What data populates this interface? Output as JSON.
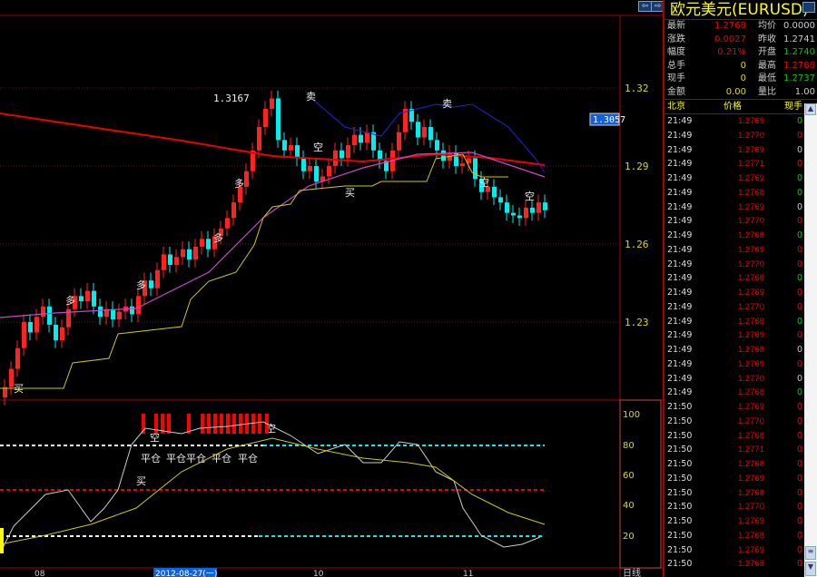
{
  "chart": {
    "nav_left": "⇦",
    "nav_right": "⇨",
    "price_ticks": [
      "1.32",
      "1.29",
      "1.26",
      "1.23"
    ],
    "current_price_tag": "1.3057",
    "peak_label": "1.3167",
    "osc_ticks": [
      "100",
      "80",
      "60",
      "40",
      "20"
    ],
    "date_ticks": [
      "08",
      "10",
      "11"
    ],
    "cursor_date": "2012-08-27(一)",
    "period": "日线",
    "signals": {
      "sell": "卖",
      "buy": "买",
      "short": "空",
      "long": "多",
      "close": "平仓"
    }
  },
  "chart_data": {
    "type": "candlestick",
    "ylim": [
      1.2,
      1.335
    ],
    "closes": [
      1.205,
      1.212,
      1.22,
      1.23,
      1.226,
      1.232,
      1.236,
      1.229,
      1.223,
      1.228,
      1.235,
      1.24,
      1.238,
      1.242,
      1.236,
      1.232,
      1.235,
      1.231,
      1.234,
      1.236,
      1.233,
      1.24,
      1.246,
      1.243,
      1.25,
      1.256,
      1.252,
      1.255,
      1.258,
      1.254,
      1.259,
      1.262,
      1.258,
      1.263,
      1.266,
      1.27,
      1.276,
      1.282,
      1.288,
      1.296,
      1.305,
      1.312,
      1.316,
      1.3,
      1.296,
      1.298,
      1.293,
      1.288,
      1.29,
      1.284,
      1.286,
      1.29,
      1.296,
      1.293,
      1.298,
      1.302,
      1.299,
      1.303,
      1.296,
      1.292,
      1.288,
      1.296,
      1.303,
      1.312,
      1.307,
      1.301,
      1.305,
      1.3,
      1.296,
      1.292,
      1.295,
      1.29,
      1.291,
      1.293,
      1.285,
      1.28,
      1.282,
      1.278,
      1.276,
      1.272,
      1.271,
      1.27,
      1.274,
      1.272,
      1.276,
      1.273
    ]
  },
  "panel": {
    "title": "欧元美元(EURUSD)",
    "stats": [
      {
        "l1": "最新",
        "v1": "1.2768",
        "c1": "#e00",
        "l2": "均价",
        "v2": "0.0000",
        "c2": "#ccc"
      },
      {
        "l1": "涨跌",
        "v1": "0.0027",
        "c1": "#e00",
        "l2": "昨收",
        "v2": "1.2741",
        "c2": "#ccc"
      },
      {
        "l1": "幅度",
        "v1": "0.21%",
        "c1": "#e00",
        "l2": "开盘",
        "v2": "1.2740",
        "c2": "#0c0"
      },
      {
        "l1": "总手",
        "v1": "0",
        "c1": "#dd0",
        "l2": "最高",
        "v2": "1.2788",
        "c2": "#e00"
      },
      {
        "l1": "现手",
        "v1": "0",
        "c1": "#dd0",
        "l2": "最低",
        "v2": "1.2737",
        "c2": "#0c0"
      },
      {
        "l1": "金额",
        "v1": "0.00",
        "c1": "#dd0",
        "l2": "量比",
        "v2": "1.00",
        "c2": "#ccc"
      }
    ],
    "list_headers": [
      "北京",
      "价格",
      "现手"
    ],
    "ticks": [
      [
        "21:49",
        "1.2769",
        "0",
        "#0c0"
      ],
      [
        "21:49",
        "1.2770",
        "0",
        "#e00"
      ],
      [
        "21:49",
        "1.2769",
        "0",
        "#ccc"
      ],
      [
        "21:49",
        "1.2771",
        "0",
        "#e00"
      ],
      [
        "21:49",
        "1.2769",
        "0",
        "#0c0"
      ],
      [
        "21:49",
        "1.2768",
        "0",
        "#0c0"
      ],
      [
        "21:49",
        "1.2769",
        "0",
        "#ccc"
      ],
      [
        "21:49",
        "1.2770",
        "0",
        "#e00"
      ],
      [
        "21:49",
        "1.2768",
        "0",
        "#0c0"
      ],
      [
        "21:49",
        "1.2769",
        "0",
        "#e00"
      ],
      [
        "21:49",
        "1.2770",
        "0",
        "#e00"
      ],
      [
        "21:49",
        "1.2768",
        "0",
        "#0c0"
      ],
      [
        "21:49",
        "1.2769",
        "0",
        "#e00"
      ],
      [
        "21:49",
        "1.2770",
        "0",
        "#e00"
      ],
      [
        "21:49",
        "1.2768",
        "0",
        "#0c0"
      ],
      [
        "21:49",
        "1.2769",
        "0",
        "#e00"
      ],
      [
        "21:49",
        "1.2768",
        "0",
        "#ccc"
      ],
      [
        "21:49",
        "1.2769",
        "0",
        "#e00"
      ],
      [
        "21:49",
        "1.2770",
        "0",
        "#ccc"
      ],
      [
        "21:49",
        "1.2768",
        "0",
        "#0c0"
      ],
      [
        "21:50",
        "1.2769",
        "0",
        "#e00"
      ],
      [
        "21:50",
        "1.2770",
        "0",
        "#e00"
      ],
      [
        "21:50",
        "1.2768",
        "0",
        "#e00"
      ],
      [
        "21:50",
        "1.2771",
        "0",
        "#e00"
      ],
      [
        "21:50",
        "1.2768",
        "0",
        "#e00"
      ],
      [
        "21:50",
        "1.2769",
        "0",
        "#e00"
      ],
      [
        "21:50",
        "1.2768",
        "0",
        "#e00"
      ],
      [
        "21:50",
        "1.2770",
        "0",
        "#e00"
      ],
      [
        "21:50",
        "1.2769",
        "0",
        "#e00"
      ],
      [
        "21:50",
        "1.2768",
        "0",
        "#e00"
      ],
      [
        "21:50",
        "1.2769",
        "0",
        "#e00"
      ],
      [
        "21:50",
        "1.2768",
        "0",
        "#e00"
      ]
    ]
  }
}
